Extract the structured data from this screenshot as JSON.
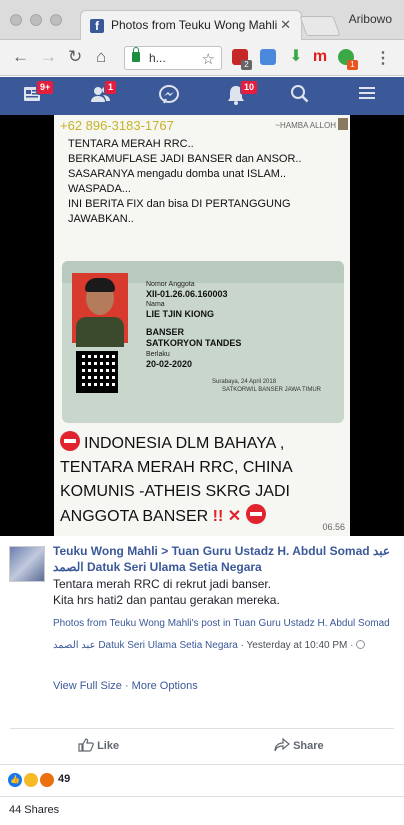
{
  "browser": {
    "tab_title": "Photos from Teuku Wong Mahli",
    "profile_name": "Aribowo",
    "url_text": "h..."
  },
  "extensions": {
    "badge_1": "2",
    "badge_2": "1"
  },
  "fb_nav": {
    "feed_badge": "9+",
    "friends_badge": "1",
    "notifications_badge": "10"
  },
  "photo": {
    "phone": "+62 896-3183-1767",
    "hamba": "~HAMBA ALLOH",
    "message": "TENTARA MERAH RRC..\nBERKAMUFLASE JADI BANSER dan ANSOR..\nSASARANYA mengadu domba unat ISLAM..\nWASPADA...\nINI BERITA FIX dan bisa DI PERTANGGUNG JAWABKAN..",
    "card": {
      "label_number": "Nomor Anggota",
      "number": "XII-01.26.06.160003",
      "label_name": "Nama",
      "name": "LIE TJIN KIONG",
      "unit1": "BANSER",
      "unit2": "SATKORYON TANDES",
      "label_valid": "Berlaku",
      "valid": "20-02-2020",
      "issued": "Surabaya, 24 April 2018",
      "org": "SATKORWIL BANSER JAWA TIMUR"
    },
    "warning_line1": "INDONESIA DLM BAHAYA ,",
    "warning_line2": "TENTARA MERAH RRC,  CHINA",
    "warning_line3": "KOMUNIS -ATHEIS SKRG JADI",
    "warning_line4": "ANGGOTA BANSER",
    "warning_marks": "!! ✕",
    "timestamp": "06.56"
  },
  "post": {
    "author": "Teuku Wong Mahli",
    "separator": ">",
    "target_1": "Tuan Guru Ustadz H. Abdul Somad",
    "target_2": "عبد الصمد Datuk Seri Ulama Setia Negara",
    "body_line1": "Tentara merah RRC di rekrut jadi banser.",
    "body_line2": "Kita hrs hati2 dan pantau gerakan mereka.",
    "meta_link": "Photos from Teuku Wong Mahli's post in Tuan Guru Ustadz H. Abdul Somad عبد الصمد Datuk Seri Ulama Setia Negara",
    "meta_time": " · Yesterday at 10:40 PM · ",
    "view_full_size": "View Full Size",
    "link_separator": " · ",
    "more_options": "More Options",
    "like_label": "Like",
    "share_label": "Share"
  },
  "reactions": {
    "count": "49",
    "colors": {
      "like": "#1877f2",
      "wow": "#f7b928",
      "angry": "#e9710f"
    }
  },
  "shares": {
    "label": "44 Shares"
  }
}
